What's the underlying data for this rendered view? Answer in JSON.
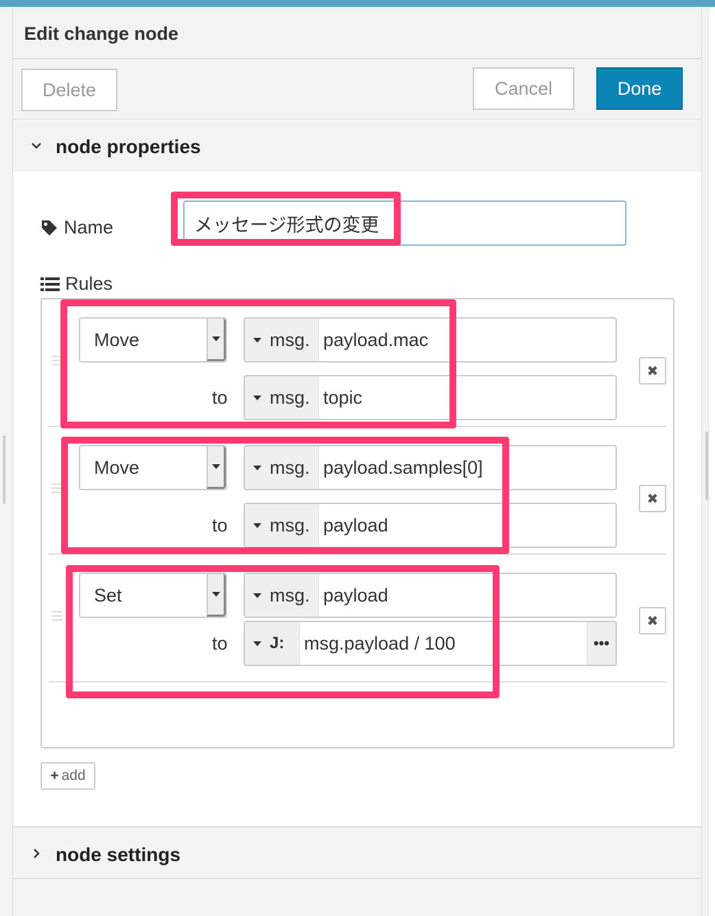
{
  "header": {
    "title": "Edit change node"
  },
  "toolbar": {
    "delete_label": "Delete",
    "cancel_label": "Cancel",
    "done_label": "Done"
  },
  "sections": {
    "properties_label": "node properties",
    "settings_label": "node settings"
  },
  "name_field": {
    "label": "Name",
    "value": "メッセージ形式の変更"
  },
  "rules_label": "Rules",
  "rules": [
    {
      "action": "Move",
      "from_prefix": "msg.",
      "from_value": "payload.mac",
      "to_label": "to",
      "to_prefix": "msg.",
      "to_value": "topic"
    },
    {
      "action": "Move",
      "from_prefix": "msg.",
      "from_value": "payload.samples[0]",
      "to_label": "to",
      "to_prefix": "msg.",
      "to_value": "payload"
    },
    {
      "action": "Set",
      "from_prefix": "msg.",
      "from_value": "payload",
      "to_label": "to",
      "to_type_glyph": "J:",
      "to_value": "msg.payload / 100",
      "expand_glyph": "•••"
    }
  ],
  "delete_rule_glyph": "✖",
  "add_label": "add",
  "add_glyph": "+",
  "colors": {
    "primary": "#0b84b6",
    "highlight": "#ff3a72",
    "topbar": "#58a2c5"
  },
  "icons": [
    "tag-icon",
    "list-icon",
    "chevron-down-icon",
    "chevron-right-icon",
    "caret-down-icon",
    "close-icon",
    "plus-icon",
    "jsonata-icon",
    "ellipsis-icon"
  ]
}
